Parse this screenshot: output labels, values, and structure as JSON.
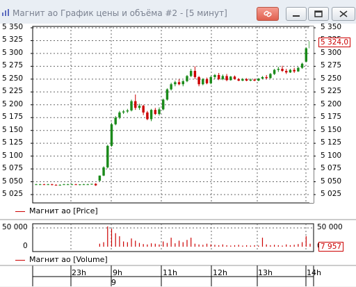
{
  "window": {
    "title": "Магнит ао График цены и объёма #2 - [5 минут]",
    "icons": {
      "app": "chart-icon",
      "link": "link-icon",
      "minimize": "minimize-icon",
      "maximize": "maximize-icon",
      "close": "close-icon"
    }
  },
  "price_panel": {
    "legend": "Магнит ао [Price]",
    "last_value": "5 324,0",
    "y_ticks_left": [
      "5 350",
      "5 325",
      "5 300",
      "5 275",
      "5 250",
      "5 225",
      "5 200",
      "5 175",
      "5 150",
      "5 125",
      "5 100",
      "5 075",
      "5 050",
      "5 025"
    ],
    "y_ticks_right": [
      "5 350",
      "5 325",
      "5 300",
      "5 275",
      "5 250",
      "5 225",
      "5 200",
      "5 175",
      "5 150",
      "5 125",
      "5 100",
      "5 075",
      "5 050",
      "5 025"
    ]
  },
  "volume_panel": {
    "legend": "Магнит ао [Volume]",
    "last_value": "7 957",
    "y_ticks_left": [
      "50 000",
      "0"
    ],
    "y_ticks_right": [
      "50 000",
      "0"
    ]
  },
  "time_axis": {
    "labels": [
      "23h",
      "9h",
      "11h",
      "12h",
      "13h",
      "14h"
    ],
    "date_label": "9"
  },
  "chart_data": {
    "type": "candlestick",
    "title": "Магнит ао График цены и объёма #2 - [5 минут]",
    "ylim": [
      5015,
      5355
    ],
    "up_color": "#1a8a1a",
    "down_color": "#cc0000",
    "candles": [
      {
        "o": 5045,
        "h": 5046,
        "l": 5044,
        "c": 5045
      },
      {
        "o": 5045,
        "h": 5046,
        "l": 5044,
        "c": 5045
      },
      {
        "o": 5045,
        "h": 5046,
        "l": 5044,
        "c": 5044
      },
      {
        "o": 5044,
        "h": 5046,
        "l": 5044,
        "c": 5045
      },
      {
        "o": 5045,
        "h": 5046,
        "l": 5043,
        "c": 5044
      },
      {
        "o": 5044,
        "h": 5045,
        "l": 5043,
        "c": 5043
      },
      {
        "o": 5043,
        "h": 5045,
        "l": 5043,
        "c": 5044
      },
      {
        "o": 5044,
        "h": 5046,
        "l": 5044,
        "c": 5045
      },
      {
        "o": 5045,
        "h": 5046,
        "l": 5044,
        "c": 5045
      },
      {
        "o": 5045,
        "h": 5046,
        "l": 5044,
        "c": 5045
      },
      {
        "o": 5045,
        "h": 5046,
        "l": 5044,
        "c": 5044
      },
      {
        "o": 5044,
        "h": 5045,
        "l": 5043,
        "c": 5045
      },
      {
        "o": 5045,
        "h": 5046,
        "l": 5044,
        "c": 5045
      },
      {
        "o": 5045,
        "h": 5046,
        "l": 5044,
        "c": 5045
      },
      {
        "o": 5045,
        "h": 5046,
        "l": 5044,
        "c": 5046
      },
      {
        "o": 5046,
        "h": 5047,
        "l": 5042,
        "c": 5043
      },
      {
        "o": 5052,
        "h": 5062,
        "l": 5051,
        "c": 5062
      },
      {
        "o": 5062,
        "h": 5080,
        "l": 5061,
        "c": 5078
      },
      {
        "o": 5078,
        "h": 5122,
        "l": 5076,
        "c": 5120
      },
      {
        "o": 5120,
        "h": 5165,
        "l": 5118,
        "c": 5162
      },
      {
        "o": 5162,
        "h": 5178,
        "l": 5160,
        "c": 5175
      },
      {
        "o": 5175,
        "h": 5188,
        "l": 5172,
        "c": 5185
      },
      {
        "o": 5185,
        "h": 5190,
        "l": 5182,
        "c": 5187
      },
      {
        "o": 5187,
        "h": 5192,
        "l": 5184,
        "c": 5189
      },
      {
        "o": 5189,
        "h": 5210,
        "l": 5187,
        "c": 5207
      },
      {
        "o": 5207,
        "h": 5220,
        "l": 5190,
        "c": 5194
      },
      {
        "o": 5194,
        "h": 5202,
        "l": 5190,
        "c": 5198
      },
      {
        "o": 5198,
        "h": 5200,
        "l": 5180,
        "c": 5185
      },
      {
        "o": 5185,
        "h": 5188,
        "l": 5170,
        "c": 5172
      },
      {
        "o": 5172,
        "h": 5192,
        "l": 5168,
        "c": 5190
      },
      {
        "o": 5190,
        "h": 5194,
        "l": 5180,
        "c": 5182
      },
      {
        "o": 5182,
        "h": 5195,
        "l": 5179,
        "c": 5191
      },
      {
        "o": 5191,
        "h": 5212,
        "l": 5189,
        "c": 5210
      },
      {
        "o": 5210,
        "h": 5232,
        "l": 5208,
        "c": 5230
      },
      {
        "o": 5230,
        "h": 5243,
        "l": 5228,
        "c": 5240
      },
      {
        "o": 5240,
        "h": 5247,
        "l": 5236,
        "c": 5244
      },
      {
        "o": 5244,
        "h": 5250,
        "l": 5238,
        "c": 5240
      },
      {
        "o": 5240,
        "h": 5248,
        "l": 5236,
        "c": 5246
      },
      {
        "o": 5246,
        "h": 5258,
        "l": 5244,
        "c": 5256
      },
      {
        "o": 5256,
        "h": 5270,
        "l": 5254,
        "c": 5266
      },
      {
        "o": 5266,
        "h": 5275,
        "l": 5250,
        "c": 5254
      },
      {
        "o": 5254,
        "h": 5256,
        "l": 5236,
        "c": 5240
      },
      {
        "o": 5240,
        "h": 5252,
        "l": 5238,
        "c": 5250
      },
      {
        "o": 5250,
        "h": 5253,
        "l": 5240,
        "c": 5242
      },
      {
        "o": 5242,
        "h": 5256,
        "l": 5240,
        "c": 5254
      },
      {
        "o": 5254,
        "h": 5260,
        "l": 5250,
        "c": 5258
      },
      {
        "o": 5258,
        "h": 5262,
        "l": 5248,
        "c": 5250
      },
      {
        "o": 5250,
        "h": 5259,
        "l": 5248,
        "c": 5256
      },
      {
        "o": 5256,
        "h": 5260,
        "l": 5246,
        "c": 5248
      },
      {
        "o": 5248,
        "h": 5256,
        "l": 5247,
        "c": 5255
      },
      {
        "o": 5255,
        "h": 5257,
        "l": 5249,
        "c": 5250
      },
      {
        "o": 5250,
        "h": 5252,
        "l": 5246,
        "c": 5247
      },
      {
        "o": 5247,
        "h": 5252,
        "l": 5246,
        "c": 5250
      },
      {
        "o": 5250,
        "h": 5252,
        "l": 5246,
        "c": 5247
      },
      {
        "o": 5247,
        "h": 5251,
        "l": 5246,
        "c": 5249
      },
      {
        "o": 5249,
        "h": 5251,
        "l": 5246,
        "c": 5247
      },
      {
        "o": 5247,
        "h": 5252,
        "l": 5246,
        "c": 5251
      },
      {
        "o": 5251,
        "h": 5256,
        "l": 5250,
        "c": 5254
      },
      {
        "o": 5254,
        "h": 5258,
        "l": 5250,
        "c": 5252
      },
      {
        "o": 5252,
        "h": 5262,
        "l": 5251,
        "c": 5260
      },
      {
        "o": 5260,
        "h": 5270,
        "l": 5258,
        "c": 5268
      },
      {
        "o": 5268,
        "h": 5274,
        "l": 5264,
        "c": 5270
      },
      {
        "o": 5270,
        "h": 5276,
        "l": 5264,
        "c": 5266
      },
      {
        "o": 5266,
        "h": 5270,
        "l": 5260,
        "c": 5263
      },
      {
        "o": 5263,
        "h": 5270,
        "l": 5262,
        "c": 5268
      },
      {
        "o": 5268,
        "h": 5272,
        "l": 5262,
        "c": 5265
      },
      {
        "o": 5265,
        "h": 5274,
        "l": 5264,
        "c": 5272
      },
      {
        "o": 5272,
        "h": 5282,
        "l": 5270,
        "c": 5280
      },
      {
        "o": 5284,
        "h": 5312,
        "l": 5283,
        "c": 5310
      },
      {
        "o": 5310,
        "h": 5326,
        "l": 5308,
        "c": 5324
      }
    ],
    "volume": [
      0,
      0,
      0,
      0,
      0,
      0,
      0,
      0,
      0,
      0,
      0,
      0,
      0,
      0,
      0,
      0,
      8000,
      12000,
      54000,
      48000,
      36000,
      28000,
      14000,
      12000,
      22000,
      16000,
      10000,
      7000,
      6000,
      9000,
      8000,
      6000,
      14000,
      10000,
      24000,
      9000,
      16000,
      12000,
      18000,
      24000,
      8000,
      6000,
      5000,
      8000,
      6000,
      5000,
      4000,
      6000,
      4000,
      3000,
      4000,
      5000,
      3000,
      4000,
      3000,
      4000,
      3000,
      24000,
      6000,
      4000,
      5000,
      4000,
      3000,
      6000,
      4000,
      5000,
      7000,
      12000,
      28000,
      7957
    ],
    "volume_ylim": [
      0,
      60000
    ]
  }
}
